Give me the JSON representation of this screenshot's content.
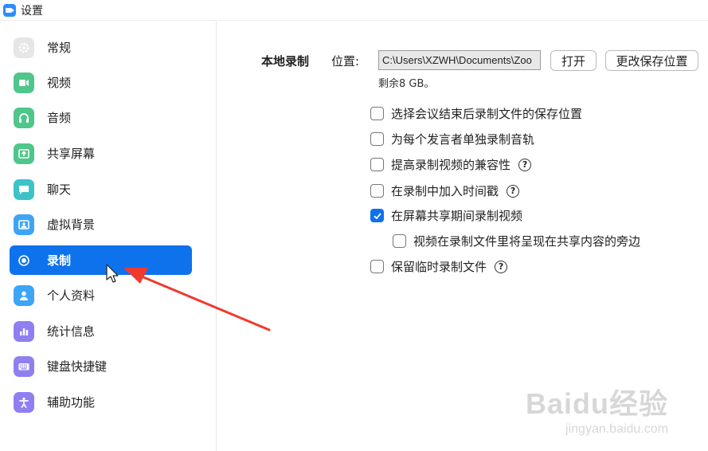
{
  "window": {
    "title": "设置"
  },
  "sidebar": {
    "items": [
      {
        "label": "常规",
        "icon": "gear-icon",
        "color": "#e6e6e6",
        "active": false
      },
      {
        "label": "视频",
        "icon": "video-icon",
        "color": "#4fc68a",
        "active": false
      },
      {
        "label": "音频",
        "icon": "headphones-icon",
        "color": "#4fc68a",
        "active": false
      },
      {
        "label": "共享屏幕",
        "icon": "share-screen-icon",
        "color": "#4fc68a",
        "active": false
      },
      {
        "label": "聊天",
        "icon": "chat-icon",
        "color": "#3cc3c8",
        "active": false
      },
      {
        "label": "虚拟背景",
        "icon": "virtual-background-icon",
        "color": "#3ea5f5",
        "active": false
      },
      {
        "label": "录制",
        "icon": "record-icon",
        "color": "#0e72ed",
        "active": true
      },
      {
        "label": "个人资料",
        "icon": "profile-icon",
        "color": "#3ea5f5",
        "active": false
      },
      {
        "label": "统计信息",
        "icon": "statistics-icon",
        "color": "#8f7ff0",
        "active": false
      },
      {
        "label": "键盘快捷键",
        "icon": "keyboard-icon",
        "color": "#8f7ff0",
        "active": false
      },
      {
        "label": "辅助功能",
        "icon": "accessibility-icon",
        "color": "#8f7ff0",
        "active": false
      }
    ]
  },
  "recording": {
    "section_title": "本地录制",
    "location_label": "位置:",
    "path_value": "C:\\Users\\XZWH\\Documents\\Zoo",
    "open_button": "打开",
    "change_button": "更改保存位置",
    "free_space": "剩余8 GB。",
    "options": [
      {
        "label": "选择会议结束后录制文件的保存位置",
        "checked": false,
        "help": false
      },
      {
        "label": "为每个发言者单独录制音轨",
        "checked": false,
        "help": false
      },
      {
        "label": "提高录制视频的兼容性",
        "checked": false,
        "help": true
      },
      {
        "label": "在录制中加入时间戳",
        "checked": false,
        "help": true
      },
      {
        "label": "在屏幕共享期间录制视频",
        "checked": true,
        "help": false
      },
      {
        "label": "视频在录制文件里将呈现在共享内容的旁边",
        "checked": false,
        "help": false
      },
      {
        "label": "保留临时录制文件",
        "checked": false,
        "help": true
      }
    ],
    "help_glyph": "?"
  },
  "watermark": {
    "main": "Baidu经验",
    "sub": "jingyan.baidu.com"
  },
  "colors": {
    "accent": "#0e72ed",
    "annotation": "#f03a2e"
  }
}
